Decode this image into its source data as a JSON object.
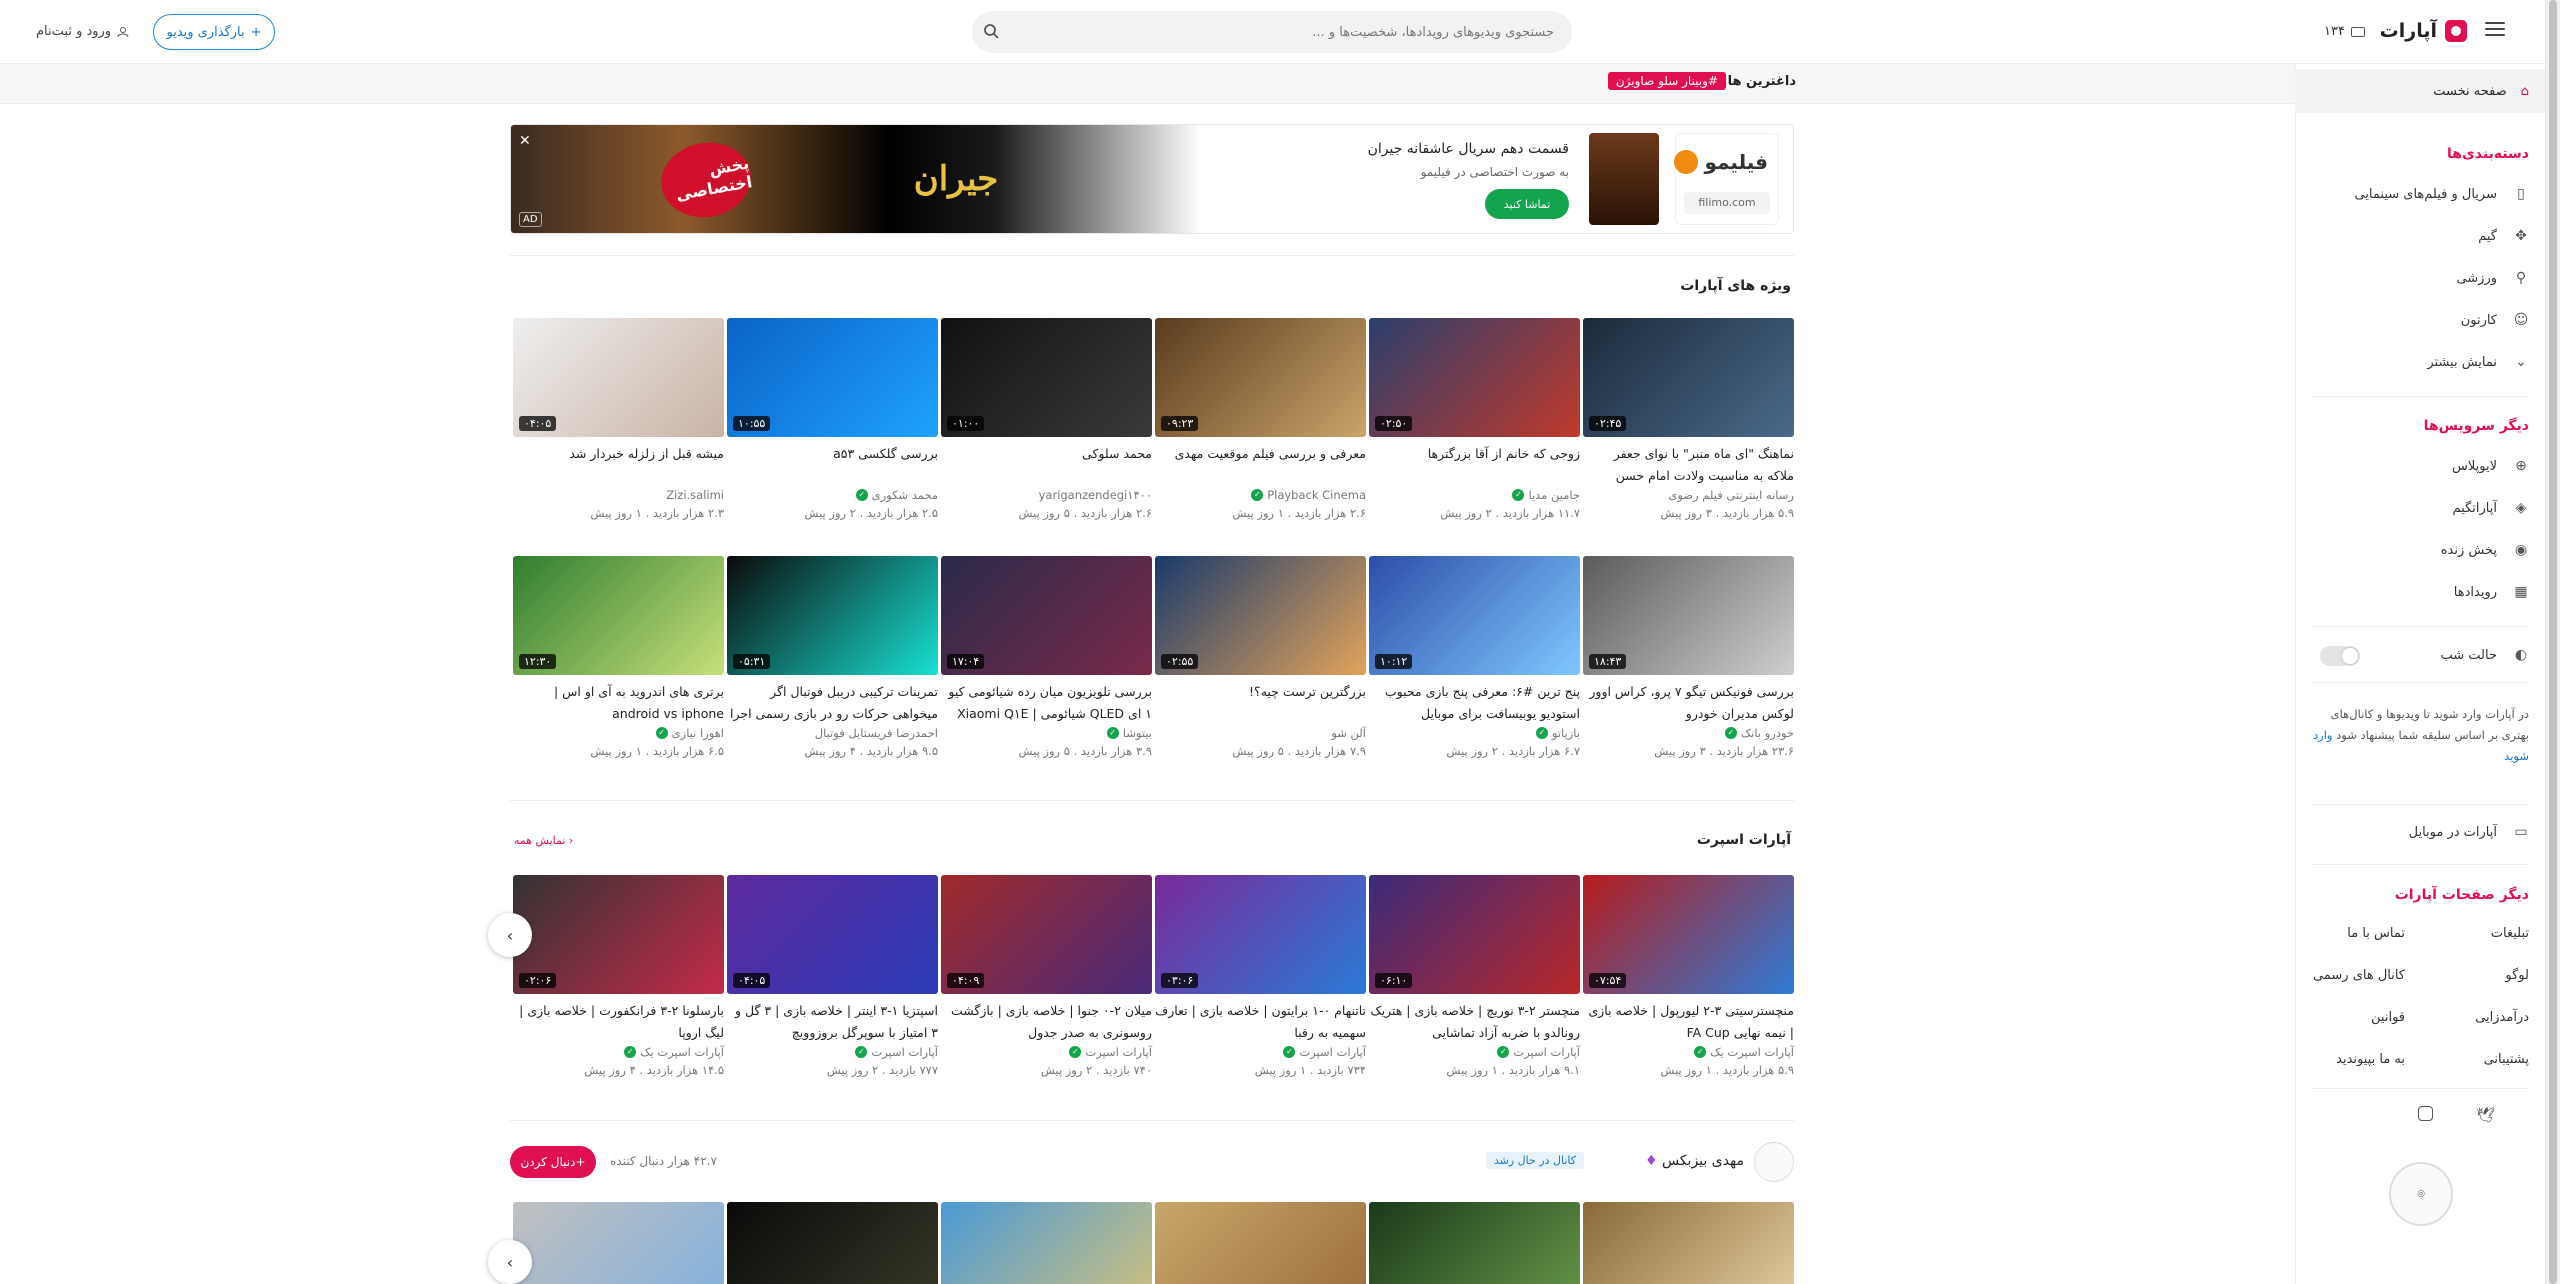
{
  "header": {
    "logo_text": "آپارات",
    "lang_label": "۱۳۴",
    "search_placeholder": "جستجوی ویدیوهای رویدادها، شخصیت‌ها و ...",
    "upload_label": "بارگذاری ویدیو",
    "login_label": "ورود و ثبت‌نام"
  },
  "strip": {
    "label": "داغترین ها:",
    "tag": "#وبینار سلو صاویژن"
  },
  "sidebar": {
    "home": "صفحه نخست",
    "categories_head": "دسته‌بندی‌ها",
    "categories": [
      "سریال و فیلم‌های سینمایی",
      "گیم",
      "ورزشی",
      "کارتون",
      "نمایش بیشتر"
    ],
    "services_head": "دیگر سرویس‌ها",
    "services": [
      "لایوپلاس",
      "آپاراتگیم",
      "پخش زنده",
      "رویدادها"
    ],
    "dark_mode": "حالت شب",
    "note": "در آپارات وارد شوید تا ویدیوها و کانال‌های بهتری بر اساس سلیقه شما پیشنهاد شود",
    "note_link": "وارد شوید",
    "mobile": "آپارات در موبایل",
    "pages_head": "دیگر صفحات آپارات",
    "pages": [
      "تبلیغات",
      "تماس با ما",
      "لوگو",
      "کانال های رسمی",
      "درآمدزایی",
      "قوانین",
      "پشتیبانی",
      "به ما بپیوندید"
    ]
  },
  "ad": {
    "brand": "فیلیمو",
    "url": "filimo.com",
    "title": "قسمت دهم سریال عاشقانه جیران",
    "subtitle": "به صورت اختصاصی در فیلیمو",
    "cta": "تماشا کنید",
    "banner_title": "جیران",
    "banner_stamp": "پخش اختصاصی",
    "tag": "AD"
  },
  "section1": {
    "title": "ویژه های آپارات",
    "row1": [
      {
        "title": "نماهنگ \"ای ماه منبر\" با نوای جعفر ملاکه به مناسبت ولادت امام حسن",
        "channel": "رسانه اینترنتی فیلم رضوی",
        "meta": "۵.۹ هزار بازدید . ۳ روز پیش",
        "dur": "۰۲:۴۵",
        "verified": false
      },
      {
        "title": "زوجی که خانم از آقا بزرگترها",
        "channel": "جامین مدیا",
        "meta": "۱۱.۷ هزار بازدید . ۲ روز پیش",
        "dur": "۰۲:۵۰",
        "verified": true
      },
      {
        "title": "معرفی و بررسی فیلم موقعیت مهدی",
        "channel": "Playback Cinema",
        "meta": "۲.۶ هزار بازدید . ۱ روز پیش",
        "dur": "۰۹:۲۳",
        "verified": true
      },
      {
        "title": "محمد سلوکی",
        "channel": "yariganzendegi۱۴۰۰",
        "meta": "۲.۶ هزار بازدید . ۵ روز پیش",
        "dur": "۰۱:۰۰",
        "verified": false
      },
      {
        "title": "بررسی گلکسی a۵۳",
        "channel": "محمد شکوری",
        "meta": "۲.۵ هزار بازدید . ۲ روز پیش",
        "dur": "۱۰:۵۵",
        "verified": true
      },
      {
        "title": "میشه قبل از زلزله خبردار شد",
        "channel": "Zizi.salimi",
        "meta": "۲.۳ هزار بازدید . ۱ روز پیش",
        "dur": "۰۴:۰۵",
        "verified": false
      }
    ],
    "row2": [
      {
        "title": "بررسی فونیکس تیگو ۷ پرو، کراس اوور لوکس مدیران خودرو",
        "channel": "خودرو بانک",
        "meta": "۲۳.۶ هزار بازدید . ۳ روز پیش",
        "dur": "۱۸:۴۳",
        "verified": true
      },
      {
        "title": "پنج ترین #۶: معرفی پنج بازی محبوب استودیو یوبیسافت برای موبایل",
        "channel": "بازیاتو",
        "meta": "۶.۷ هزار بازدید . ۲ روز پیش",
        "dur": "۱۰:۱۲",
        "verified": true
      },
      {
        "title": "بزرگترین ترست چیه؟!",
        "channel": "آلن شو",
        "meta": "۷.۹ هزار بازدید . ۵ روز پیش",
        "dur": "۰۲:۵۵",
        "verified": false
      },
      {
        "title": "بررسی تلویزیون میان رده شیائومی کیو ۱ ای QLED شیائومی | Xiaomi Q۱E",
        "channel": "بیتوشا",
        "meta": "۳.۹ هزار بازدید . ۵ روز پیش",
        "dur": "۱۷:۰۴",
        "verified": true
      },
      {
        "title": "تمرینات ترکیبی دریبل فوتبال اگر میخواهی حرکات رو در بازی رسمی اجرا",
        "channel": "احمدرضا فریستایل فوتبال",
        "meta": "۹.۵ هزار بازدید . ۴ روز پیش",
        "dur": "۰۵:۳۱",
        "verified": false
      },
      {
        "title": "برتری های اندروید به آی او اس | android vs iphone",
        "channel": "اهورا نیازی",
        "meta": "۶.۵ هزار بازدید . ۱ روز پیش",
        "dur": "۱۲:۳۰",
        "verified": true
      }
    ]
  },
  "section2": {
    "title": "آپارات اسپرت",
    "more": "نمایش همه",
    "items": [
      {
        "title": "منچسترسیتی ۳-۲ لیورپول | خلاصه بازی | نیمه نهایی FA Cup",
        "channel": "آپارات اسپرت یک",
        "meta": "۵.۹ هزار بازدید . ۱ روز پیش",
        "dur": "۰۷:۵۴",
        "verified": true
      },
      {
        "title": "منچستر ۲-۳ نوریچ | خلاصه بازی | هتریک رونالدو با ضربه آزاد تماشایی",
        "channel": "آپارات اسپرت",
        "meta": "۹.۱ هزار بازدید . ۱ روز پیش",
        "dur": "۰۶:۱۰",
        "verified": true
      },
      {
        "title": "تاتنهام ۰-۱ برایتون | خلاصه بازی | تعارف سهمیه به رقبا",
        "channel": "آپارات اسپرت",
        "meta": "۷۳۴ بازدید . ۱ روز پیش",
        "dur": "۰۳:۰۶",
        "verified": true
      },
      {
        "title": "میلان ۲-۰ جنوا | خلاصه بازی | بازگشت روسونری به صدر جدول",
        "channel": "آپارات اسپرت",
        "meta": "۷۴۰ بازدید . ۲ روز پیش",
        "dur": "۰۴:۰۹",
        "verified": true
      },
      {
        "title": "اسپتزیا ۱-۳ اینتر | خلاصه بازی | ۳ گل و ۳ امتیاز با سوپرگل بروزوویچ",
        "channel": "آپارات اسپرت",
        "meta": "۷۷۷ بازدید . ۲ روز پیش",
        "dur": "۰۴:۰۵",
        "verified": true
      },
      {
        "title": "بارسلونا ۲-۳ فرانکفورت | خلاصه بازی | لیگ اروپا",
        "channel": "آپارات اسپرت یک",
        "meta": "۱۴.۵ هزار بازدید . ۴ روز پیش",
        "dur": "۰۲:۰۶",
        "verified": true
      }
    ]
  },
  "channel_row": {
    "name": "مهدی بیزبکس",
    "badge": "کانال در حال رشد",
    "follow": "دنبال کردن",
    "followers": "۴۲.۷ هزار دنبال کننده"
  },
  "colors": {
    "accent": "#df0f50",
    "link": "#1a78c2",
    "verified": "#14a44d"
  }
}
